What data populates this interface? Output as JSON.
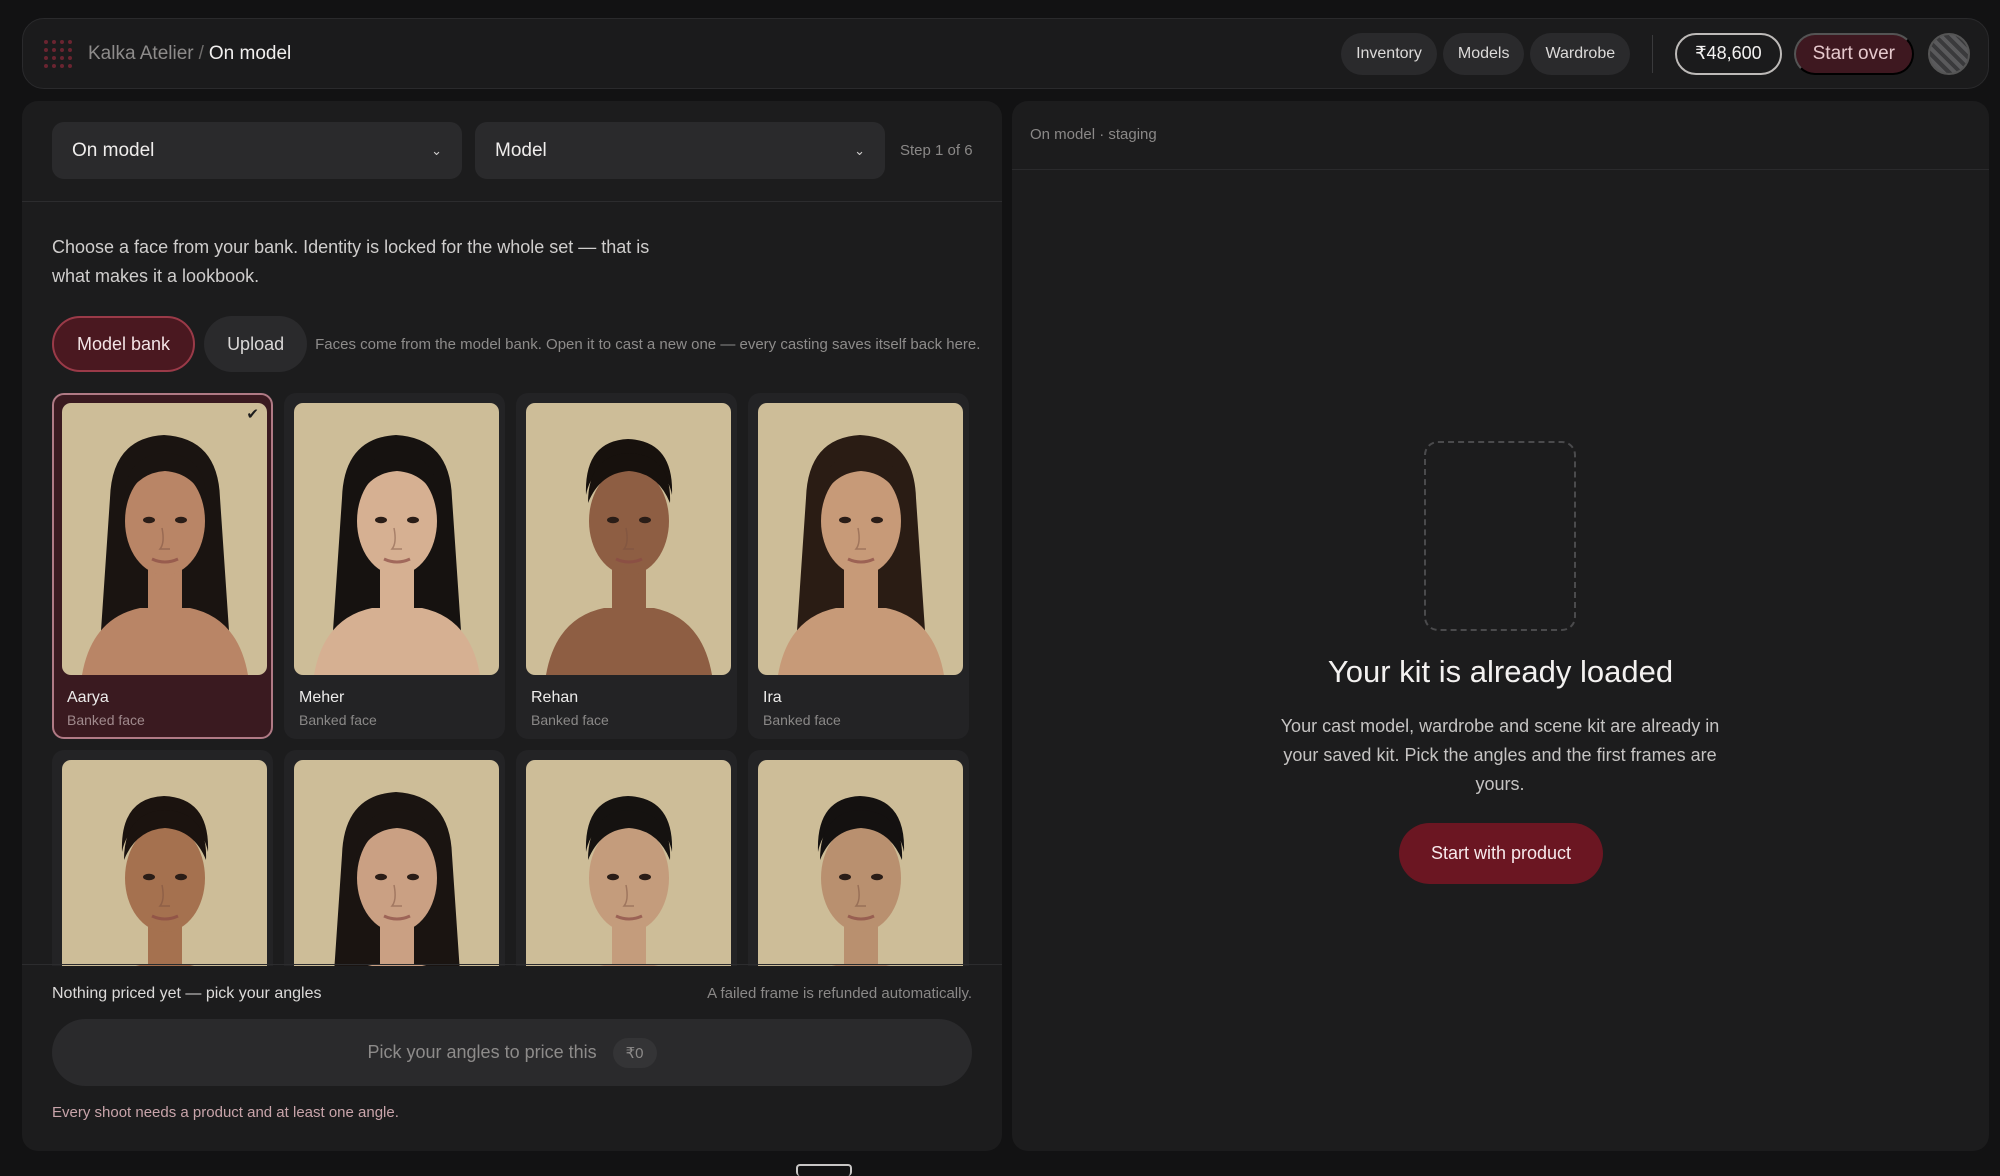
{
  "header": {
    "app_name": "Kalka Atelier",
    "separator": "/",
    "current_page": "On model",
    "nav": [
      "Inventory",
      "Models",
      "Wardrobe"
    ],
    "credits": "₹48,600",
    "start_over": "Start over"
  },
  "config": {
    "mode_select": "On model",
    "subject_select": "Model",
    "step": "Step 1 of 6"
  },
  "intro": "Choose a face from your bank. Identity is locked for the whole set — that is what makes it a lookbook.",
  "source": {
    "model_bank": "Model bank",
    "upload": "Upload",
    "note": "Faces come from the model bank. Open it to cast a new one — every casting saves itself back here."
  },
  "models": [
    {
      "name": "Aarya",
      "sub": "Banked face",
      "selected": true
    },
    {
      "name": "Meher",
      "sub": "Banked face",
      "selected": false
    },
    {
      "name": "Rehan",
      "sub": "Banked face",
      "selected": false
    },
    {
      "name": "Ira",
      "sub": "Banked face",
      "selected": false
    },
    {
      "name": "",
      "sub": "",
      "selected": false
    },
    {
      "name": "",
      "sub": "",
      "selected": false
    },
    {
      "name": "",
      "sub": "",
      "selected": false
    },
    {
      "name": "",
      "sub": "",
      "selected": false
    }
  ],
  "pricing": {
    "status": "Nothing priced yet — pick your angles",
    "refund_note": "A failed frame is refunded automatically.",
    "button_label": "Pick your angles to price this",
    "price": "₹0",
    "requirement": "Every shoot needs a product and at least one angle."
  },
  "stage": {
    "label": "On model · staging",
    "title": "Your kit is already loaded",
    "body": "Your cast model, wardrobe and scene kit are already in your saved kit. Pick the angles and the first frames are yours.",
    "cta": "Start with product"
  },
  "colors": {
    "accent": "#6b1622",
    "accent_dark": "#4a1820",
    "portrait_bg": "#cdbd98"
  }
}
